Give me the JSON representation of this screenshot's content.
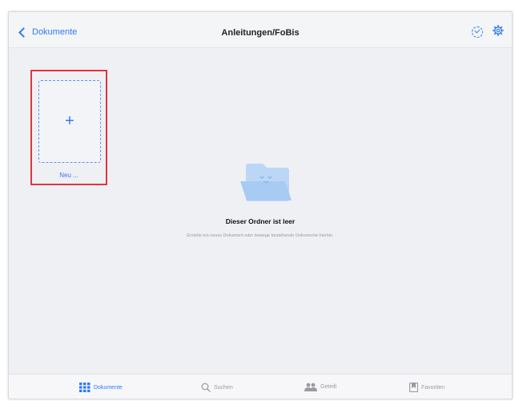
{
  "header": {
    "back_label": "Dokumente",
    "title": "Anleitungen/FoBis"
  },
  "new_item": {
    "label": "Neu ...",
    "plus": "+"
  },
  "empty_state": {
    "title": "Dieser Ordner ist leer",
    "subtitle": "Erstelle ein neues Dokument oder bewege bestehende Dokumente hierhin."
  },
  "tabs": [
    {
      "label": "Dokumente",
      "icon": "grid-icon",
      "active": true
    },
    {
      "label": "Suchen",
      "icon": "search-icon",
      "active": false
    },
    {
      "label": "Geteilt",
      "icon": "people-icon",
      "active": false
    },
    {
      "label": "Favoriten",
      "icon": "bookmark-icon",
      "active": false
    }
  ],
  "colors": {
    "accent": "#2f7bf5",
    "highlight_border": "#e0343d",
    "background": "#eff0f4"
  }
}
